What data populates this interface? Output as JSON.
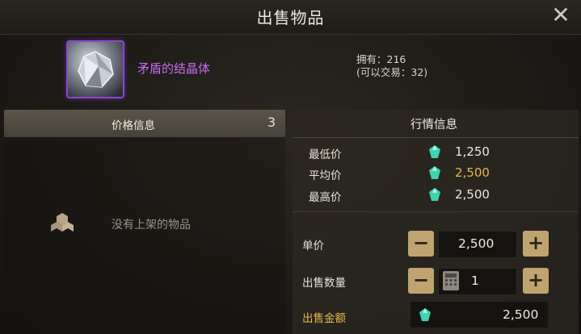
{
  "header": {
    "title": "出售物品",
    "close_icon": "close-icon"
  },
  "item": {
    "name": "矛盾的结晶体",
    "owned_line": "拥有：216",
    "tradable_line": "(可以交易：32)"
  },
  "listings": {
    "header_label": "价格信息",
    "count": "3",
    "empty_text": "没有上架的物品"
  },
  "market": {
    "header": "行情信息",
    "rows": [
      {
        "label": "最低价",
        "value": "1,250"
      },
      {
        "label": "平均价",
        "value": "2,500"
      },
      {
        "label": "最高价",
        "value": "2,500"
      }
    ]
  },
  "form": {
    "unit_price_label": "单价",
    "unit_price_value": "2,500",
    "quantity_label": "出售数量",
    "quantity_value": "1",
    "total_label": "出售金额",
    "total_value": "2,500",
    "minus": "−",
    "plus": "+"
  },
  "colors": {
    "item_name": "#c56ef0",
    "average_price": "#e6b84a",
    "total_label": "#e6b84a",
    "step_button": "#bfa370"
  }
}
